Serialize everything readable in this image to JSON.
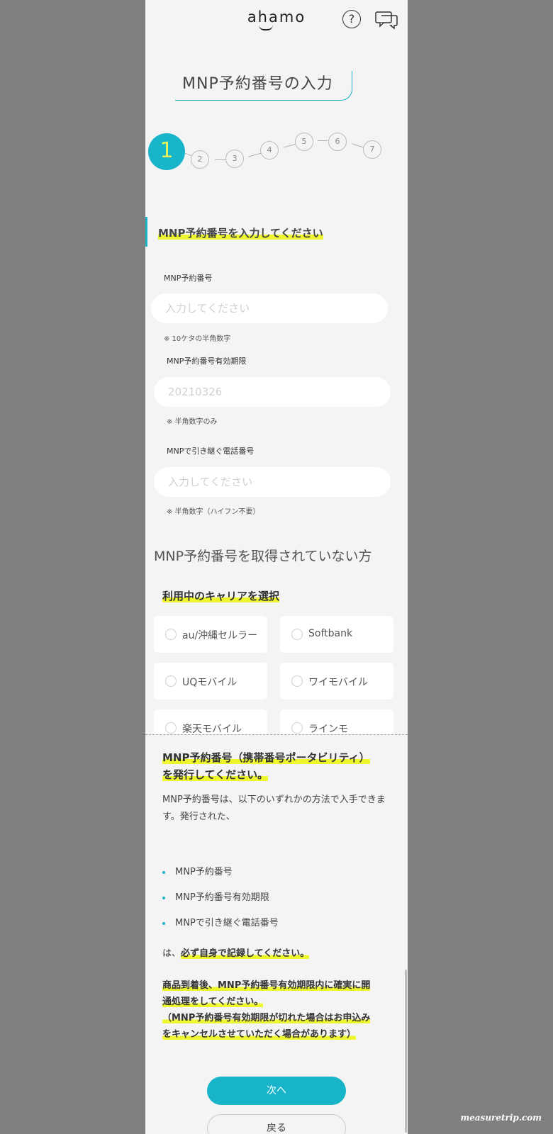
{
  "header": {
    "logo": "ahamo",
    "help_icon": "question-circle-icon",
    "chat_icon": "chat-bubbles-icon"
  },
  "page_title": "MNP予約番号の入力",
  "steps": {
    "current": "1",
    "items": [
      "2",
      "3",
      "4",
      "5",
      "6",
      "7"
    ]
  },
  "form": {
    "section_title": "MNP予約番号を入力してください",
    "mnp_number": {
      "label": "MNP予約番号",
      "placeholder": "入力してください",
      "note": "※ 10ケタの半角数字"
    },
    "expiry": {
      "label": "MNP予約番号有効期限",
      "placeholder": "20210326",
      "note": "※ 半角数字のみ"
    },
    "phone": {
      "label": "MNPで引き継ぐ電話番号",
      "placeholder": "入力してください",
      "note": "※ 半角数字（ハイフン不要）"
    }
  },
  "no_number": {
    "heading": "MNP予約番号を取得されていない方",
    "carrier_title": "利用中のキャリアを選択",
    "carriers": [
      "au/沖縄セルラー",
      "Softbank",
      "UQモバイル",
      "ワイモバイル",
      "楽天モバイル",
      "ラインモ"
    ]
  },
  "sheet": {
    "heading_line1": "MNP予約番号（携帯番号ポータビリティ）",
    "heading_line2": "を発行してください。",
    "para": "MNP予約番号は、以下のいずれかの方法で入手できます。発行された、",
    "bullets": [
      "MNP予約番号",
      "MNP予約番号有効期限",
      "MNPで引き継ぐ電話番号"
    ],
    "note1_prefix": "は、",
    "note1_bold": "必ず自身で記録してください。",
    "note2_line1": "商品到着後、MNP予約番号有効期限内に確実に開",
    "note2_line2": "通処理をしてください。",
    "note2_line3": "（MNP予約番号有効期限が切れた場合はお申込み",
    "note2_line4": "をキャンセルさせていただく場合があります）",
    "next_label": "次へ",
    "back_label": "戻る"
  },
  "watermark": "measuretrip.com",
  "colors": {
    "accent": "#18b4c9",
    "highlight": "#eef72e",
    "step_number": "#e8f55a"
  }
}
